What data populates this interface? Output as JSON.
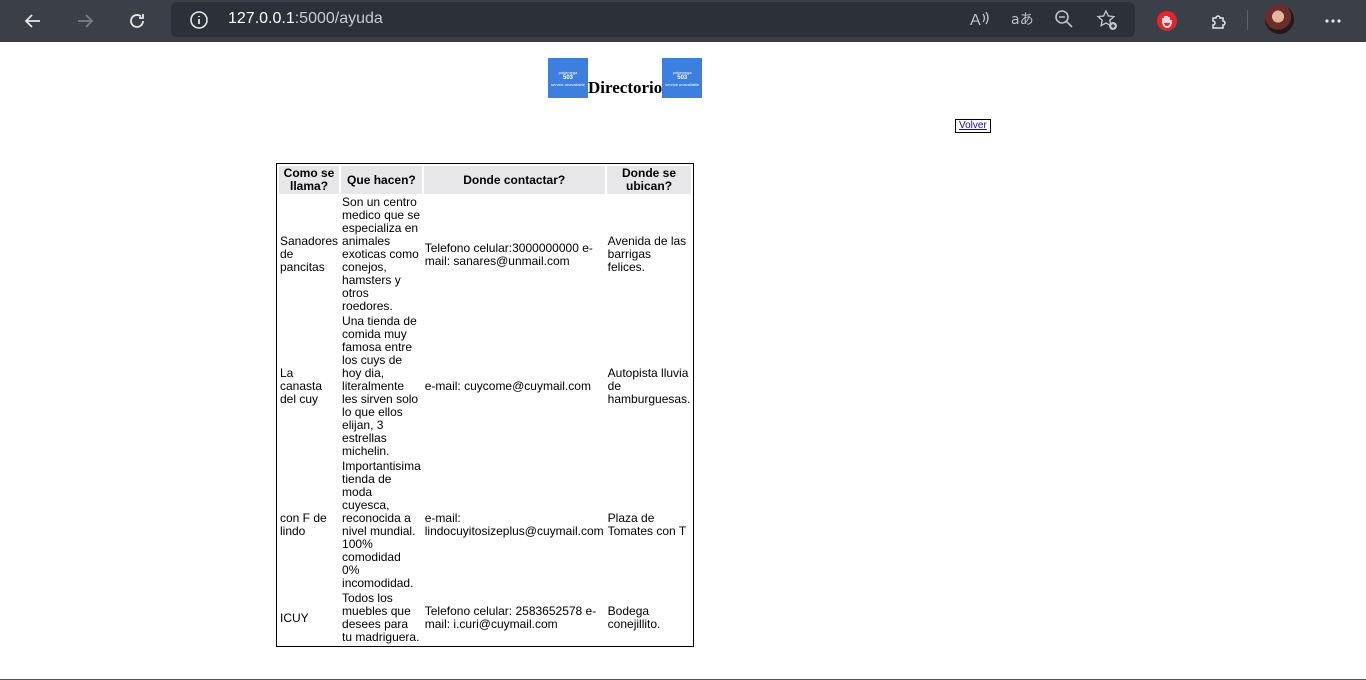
{
  "browser": {
    "url_host": "127.0.0.1",
    "url_path": ":5000/ayuda",
    "icons": [
      "back-arrow-icon",
      "forward-arrow-icon",
      "refresh-icon",
      "info-icon",
      "read-aloud-icon",
      "translate-icon",
      "zoom-out-icon",
      "favorite-add-icon",
      "adblock-icon",
      "extensions-icon",
      "profile-avatar",
      "more-menu-icon"
    ]
  },
  "header": {
    "title": "Directorio",
    "logo_text_top": "pokemega",
    "logo_text_code": "503",
    "logo_text_bottom": "service unavailable"
  },
  "volver_label": "Volver",
  "table": {
    "headers": [
      "Como se llama?",
      "Que hacen?",
      "Donde contactar?",
      "Donde se ubican?"
    ],
    "rows": [
      [
        "Sanadores de pancitas",
        "Son un centro medico que se especializa en animales exoticas como conejos, hamsters y otros roedores.",
        "Telefono celular:3000000000 e-mail: sanares@unmail.com",
        "Avenida de las barrigas felices."
      ],
      [
        "La canasta del cuy",
        "Una tienda de comida muy famosa entre los cuys de hoy dia, literalmente les sirven solo lo que ellos elijan, 3 estrellas michelin.",
        "e-mail: cuycome@cuymail.com",
        "Autopista lluvia de hamburguesas."
      ],
      [
        "con F de lindo",
        "Importantisima tienda de moda cuyesca, reconocida a nivel mundial. 100% comodidad 0% incomodidad.",
        "e-mail: lindocuyitosizeplus@cuymail.com",
        "Plaza de Tomates con T"
      ],
      [
        "ICUY",
        "Todos los muebles que desees para tu madriguera.",
        "Telefono celular: 2583652578 e-mail: i.curi@cuymail.com",
        "Bodega conejillito."
      ]
    ]
  }
}
